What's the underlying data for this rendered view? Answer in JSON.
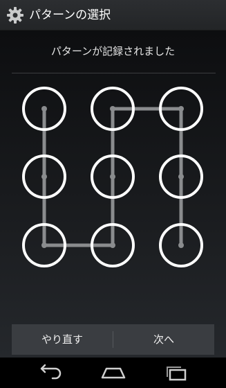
{
  "action_bar": {
    "title": "パターンの選択",
    "icon": "gear-icon"
  },
  "header": {
    "message": "パターンが記録されました"
  },
  "pattern": {
    "grid_size": 3,
    "dot_count": 9,
    "path_dots": [
      1,
      4,
      7,
      8,
      5,
      2,
      3,
      6,
      9
    ],
    "ring_color": "#ffffff",
    "line_color": "#8a8c8e",
    "center_dot_color": "#8a8c8e"
  },
  "buttons": {
    "retry_label": "やり直す",
    "next_label": "次へ"
  },
  "nav_bar": {
    "back_icon": "back-icon",
    "home_icon": "home-icon",
    "recents_icon": "recents-icon"
  },
  "colors": {
    "action_bar_bg": "#2c2e31",
    "button_bar_bg": "#3a3d41",
    "text": "#ffffff"
  }
}
